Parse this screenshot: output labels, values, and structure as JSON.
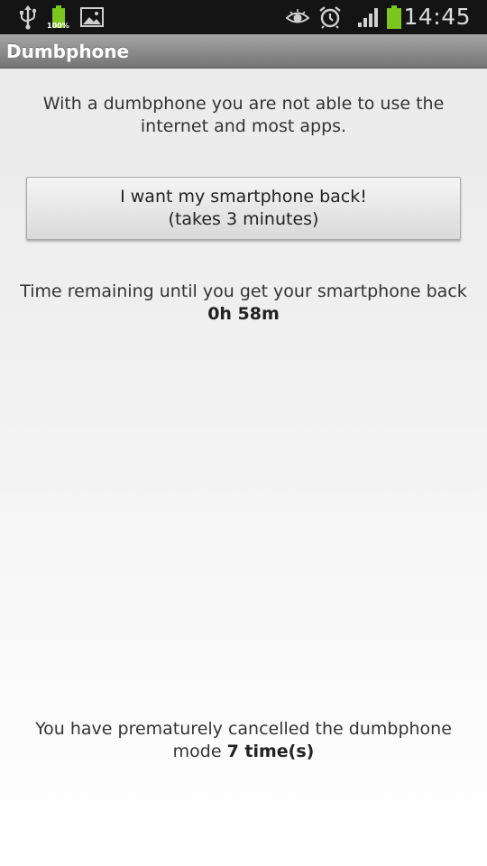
{
  "status_bar": {
    "time": "14:45",
    "battery_small_label": "100%",
    "icons": [
      "usb-icon",
      "battery-full-icon",
      "image-icon",
      "eye-icon",
      "alarm-icon",
      "signal-icon",
      "battery-icon"
    ],
    "battery_color": "#7cc51e"
  },
  "app": {
    "title": "Dumbphone"
  },
  "main": {
    "intro": "With a dumbphone you are not able to use the internet and most apps.",
    "button": {
      "line1": "I want my smartphone back!",
      "line2": "(takes 3 minutes)"
    },
    "remaining_label": "Time remaining until you get your smartphone back",
    "remaining_value": "0h 58m",
    "cancel_prefix": "You have prematurely cancelled the dumbphone mode",
    "cancel_count": "7 time(s)"
  }
}
